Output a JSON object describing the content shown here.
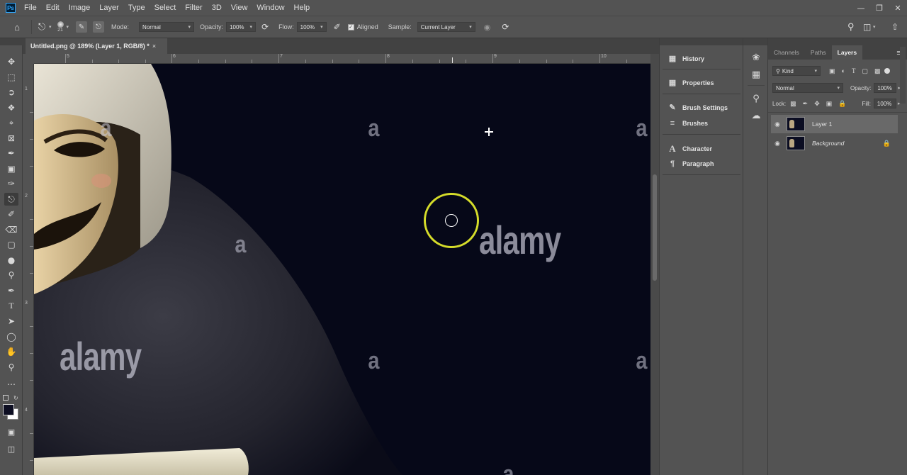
{
  "menu": {
    "app_icon": "Ps",
    "items": [
      "File",
      "Edit",
      "Image",
      "Layer",
      "Type",
      "Select",
      "Filter",
      "3D",
      "View",
      "Window",
      "Help"
    ]
  },
  "options_bar": {
    "brush_size": "21",
    "mode_label": "Mode:",
    "mode_value": "Normal",
    "opacity_label": "Opacity:",
    "opacity_value": "100%",
    "flow_label": "Flow:",
    "flow_value": "100%",
    "aligned_label": "Aligned",
    "sample_label": "Sample:",
    "sample_value": "Current Layer"
  },
  "document": {
    "tab_title": "Untitled.png @ 189% (Layer 1, RGB/8) *",
    "ruler_top": [
      "5",
      "6",
      "7",
      "8",
      "9",
      "10"
    ],
    "ruler_left": [
      "1",
      "2",
      "3",
      "4"
    ]
  },
  "canvas": {
    "watermark_small": "a",
    "watermark_large": "alamy",
    "background_color": "#060818",
    "brush_ring_color": "#d5dc2a"
  },
  "dock": {
    "items": [
      "History",
      "Properties",
      "Brush Settings",
      "Brushes",
      "Character",
      "Paragraph"
    ]
  },
  "layers_panel": {
    "tabs": [
      "Channels",
      "Paths",
      "Layers"
    ],
    "active_tab": "Layers",
    "filter_kind": "Kind",
    "blend_mode": "Normal",
    "opacity_label": "Opacity:",
    "opacity_value": "100%",
    "lock_label": "Lock:",
    "fill_label": "Fill:",
    "fill_value": "100%",
    "layers": [
      {
        "name": "Layer 1",
        "selected": true,
        "locked": false
      },
      {
        "name": "Background",
        "selected": false,
        "locked": true
      }
    ]
  }
}
